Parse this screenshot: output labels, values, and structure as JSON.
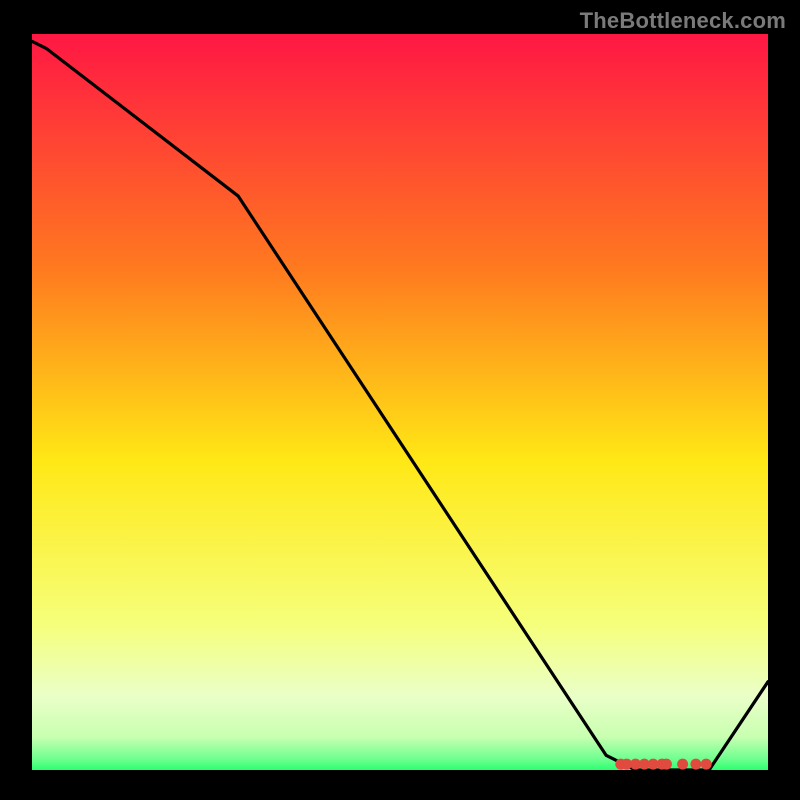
{
  "watermark": "TheBottleneck.com",
  "colors": {
    "background": "#000000",
    "watermark_text": "#7a7a7a",
    "line": "#000000",
    "marker": "#e04a3f",
    "gradient_top": "#ff1744",
    "gradient_upper_mid": "#ff9a1f",
    "gradient_mid": "#ffe815",
    "gradient_lower_mid": "#f8ffa8",
    "gradient_near_bottom": "#d4ffc2",
    "gradient_bottom": "#2cff70"
  },
  "chart_data": {
    "type": "line",
    "title": "",
    "xlabel": "",
    "ylabel": "",
    "xlim": [
      0,
      100
    ],
    "ylim": [
      0,
      100
    ],
    "legend": false,
    "grid": false,
    "line": {
      "x": [
        0,
        2,
        28,
        78,
        82,
        92,
        100
      ],
      "y": [
        99,
        98,
        78,
        2,
        0,
        0,
        12
      ]
    },
    "markers": {
      "x": [
        80,
        80.8,
        82,
        83.2,
        84.4,
        85.6,
        86.2,
        88.4,
        90.2,
        91.6
      ],
      "y": [
        0.8,
        0.8,
        0.8,
        0.8,
        0.8,
        0.8,
        0.8,
        0.8,
        0.8,
        0.8
      ]
    },
    "background_gradient": {
      "direction": "vertical",
      "stops": [
        {
          "offset": 0.0,
          "color": "#ff1744"
        },
        {
          "offset": 0.32,
          "color": "#ff7a1f"
        },
        {
          "offset": 0.58,
          "color": "#ffe815"
        },
        {
          "offset": 0.8,
          "color": "#f6ff7a"
        },
        {
          "offset": 0.9,
          "color": "#eaffc8"
        },
        {
          "offset": 0.955,
          "color": "#c8ffb0"
        },
        {
          "offset": 0.985,
          "color": "#6fff90"
        },
        {
          "offset": 1.0,
          "color": "#2cff70"
        }
      ]
    }
  }
}
